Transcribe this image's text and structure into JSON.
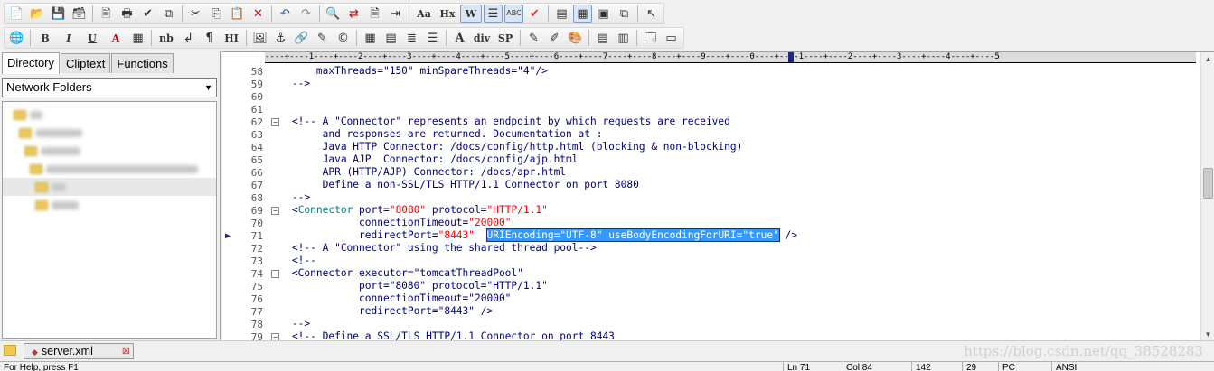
{
  "toolbar1": {
    "icons": [
      "new-file-icon",
      "open-folder-icon",
      "save-icon",
      "save-all-icon",
      "print-preview-icon",
      "print-icon",
      "spellcheck-icon",
      "spellcheck-doc-icon",
      "cut-icon",
      "copy-icon",
      "paste-icon",
      "delete-icon",
      "undo-icon",
      "redo-icon",
      "find-icon",
      "replace-icon",
      "find-in-files-icon",
      "goto-icon",
      "font-icon",
      "heading-icon",
      "word-wrap-icon",
      "ruler-toggle-icon",
      "hex-mode-icon",
      "validate-icon",
      "view-icon",
      "column-mode-icon",
      "tile-icon",
      "cascade-icon",
      "help-cursor-icon"
    ],
    "font_label": "Aa",
    "heading_label": "Hx",
    "wrap_label": "W"
  },
  "toolbar2": {
    "bold_label": "B",
    "italic_label": "I",
    "underline_label": "U",
    "font_color_label": "A",
    "nbsp_label": "nb",
    "para_label": "¶",
    "hr_label": "HI",
    "div_label": "div",
    "span_label": "SP"
  },
  "left_pane": {
    "tabs": [
      {
        "label": "Directory",
        "active": true
      },
      {
        "label": "Cliptext",
        "active": false
      },
      {
        "label": "Functions",
        "active": false
      }
    ],
    "folder_select": "Network Folders"
  },
  "ruler": "----+----1----+----2----+----3----+----4----+----5----+----6----+----7----+----8----+----9----+----0----+----1----+----2----+----3----+----4----+----5",
  "editor": {
    "lines": [
      {
        "n": "58",
        "fold": "",
        "segs": [
          [
            "c-attr",
            "        maxThreads=\"150\" minSpareThreads=\"4\"/>"
          ]
        ]
      },
      {
        "n": "59",
        "fold": "",
        "segs": [
          [
            "c-comment",
            "    -->"
          ]
        ]
      },
      {
        "n": "60",
        "fold": "",
        "segs": []
      },
      {
        "n": "61",
        "fold": "",
        "segs": []
      },
      {
        "n": "62",
        "fold": "⊟",
        "segs": [
          [
            "c-comment",
            "    <!-- A \"Connector\" represents an endpoint by which requests are received"
          ]
        ]
      },
      {
        "n": "63",
        "fold": "",
        "segs": [
          [
            "c-comment",
            "         and responses are returned. Documentation at :"
          ]
        ]
      },
      {
        "n": "64",
        "fold": "",
        "segs": [
          [
            "c-comment",
            "         Java HTTP Connector: /docs/config/http.html (blocking & non-blocking)"
          ]
        ]
      },
      {
        "n": "65",
        "fold": "",
        "segs": [
          [
            "c-comment",
            "         Java AJP  Connector: /docs/config/ajp.html"
          ]
        ]
      },
      {
        "n": "66",
        "fold": "",
        "segs": [
          [
            "c-comment",
            "         APR (HTTP/AJP) Connector: /docs/apr.html"
          ]
        ]
      },
      {
        "n": "67",
        "fold": "",
        "segs": [
          [
            "c-comment",
            "         Define a non-SSL/TLS HTTP/1.1 Connector on port 8080"
          ]
        ]
      },
      {
        "n": "68",
        "fold": "",
        "segs": [
          [
            "c-comment",
            "    -->"
          ]
        ]
      },
      {
        "n": "69",
        "fold": "⊟",
        "segs": [
          [
            "c-attr",
            "    <"
          ],
          [
            "c-tag",
            "Connector"
          ],
          [
            "c-attr",
            " port="
          ],
          [
            "c-str",
            "\"8080\""
          ],
          [
            "c-attr",
            " protocol="
          ],
          [
            "c-str",
            "\"HTTP/1.1\""
          ]
        ]
      },
      {
        "n": "70",
        "fold": "",
        "segs": [
          [
            "c-attr",
            "               connectionTimeout="
          ],
          [
            "c-str",
            "\"20000\""
          ]
        ]
      },
      {
        "n": "71",
        "fold": "",
        "caret": true,
        "segs": [
          [
            "c-attr",
            "               redirectPort="
          ],
          [
            "c-str",
            "\"8443\""
          ],
          [
            "c-attr",
            "  "
          ],
          [
            "sel",
            "URIEncoding=\"UTF-8\" useBodyEncodingForURI=\"true\""
          ],
          [
            "c-attr",
            " />"
          ]
        ]
      },
      {
        "n": "72",
        "fold": "",
        "segs": [
          [
            "c-comment",
            "    <!-- A \"Connector\" using the shared thread pool-->"
          ]
        ]
      },
      {
        "n": "73",
        "fold": "",
        "segs": [
          [
            "c-comment",
            "    <!--"
          ]
        ]
      },
      {
        "n": "74",
        "fold": "⊟",
        "segs": [
          [
            "c-comment",
            "    <Connector executor=\"tomcatThreadPool\""
          ]
        ]
      },
      {
        "n": "75",
        "fold": "",
        "segs": [
          [
            "c-comment",
            "               port=\"8080\" protocol=\"HTTP/1.1\""
          ]
        ]
      },
      {
        "n": "76",
        "fold": "",
        "segs": [
          [
            "c-comment",
            "               connectionTimeout=\"20000\""
          ]
        ]
      },
      {
        "n": "77",
        "fold": "",
        "segs": [
          [
            "c-comment",
            "               redirectPort=\"8443\" />"
          ]
        ]
      },
      {
        "n": "78",
        "fold": "",
        "segs": [
          [
            "c-comment",
            "    -->"
          ]
        ]
      },
      {
        "n": "79",
        "fold": "⊟",
        "segs": [
          [
            "c-comment",
            "    <!-- Define a SSL/TLS HTTP/1.1 Connector on port 8443"
          ]
        ]
      }
    ]
  },
  "file_tab": {
    "name": "server.xml",
    "close": "⊠"
  },
  "watermark": "https://blog.csdn.net/qq_38528283",
  "statusbar": {
    "help": "For Help, press F1",
    "line": "Ln 71",
    "col": "Col 84",
    "chars": "142",
    "num": "29",
    "type": "PC",
    "encoding": "ANSI"
  }
}
